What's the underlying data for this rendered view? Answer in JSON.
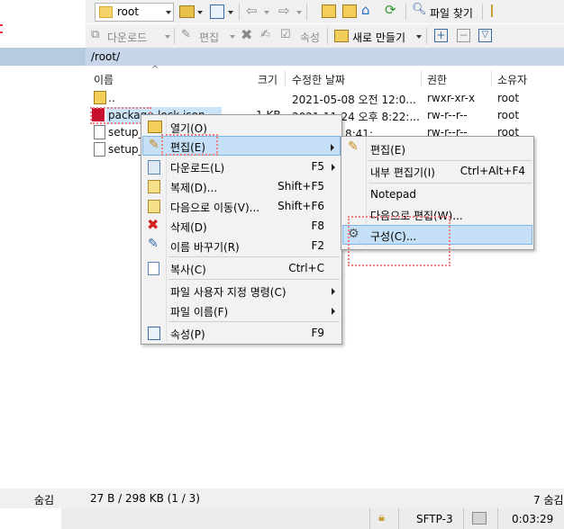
{
  "toolbar": {
    "location_value": "root",
    "find_files_label": "파일 찾기",
    "download_label": "다운로드",
    "edit_label": "편집",
    "properties_label": "속성",
    "new_label": "새로 만들기"
  },
  "path": "/root/",
  "columns": {
    "name": "이름",
    "size": "크기",
    "modified": "수정한 날짜",
    "permissions": "권한",
    "owner": "소유자"
  },
  "files": [
    {
      "name": "..",
      "size": "",
      "modified": "2021-05-08 오전 12:0...",
      "permissions": "rwxr-xr-x",
      "owner": "root"
    },
    {
      "name": "package-lock.json",
      "size": "1 KB",
      "modified": "2021-11-24 오후 8:22:...",
      "permissions": "rw-r--r--",
      "owner": "root"
    },
    {
      "name": "setup_",
      "size": "",
      "modified": "24 오후 8:41:...",
      "permissions": "rw-r--r--",
      "owner": "root"
    },
    {
      "name": "setup_",
      "size": "",
      "modified": "",
      "permissions": "",
      "owner": ""
    }
  ],
  "context_menu": {
    "items": [
      {
        "label": "열기(O)",
        "shortcut": ""
      },
      {
        "label": "편집(E)",
        "shortcut": ""
      },
      {
        "label": "다운로드(L)",
        "shortcut": "F5"
      },
      {
        "label": "복제(D)...",
        "shortcut": "Shift+F5"
      },
      {
        "label": "다음으로 이동(V)...",
        "shortcut": "Shift+F6"
      },
      {
        "label": "삭제(D)",
        "shortcut": "F8"
      },
      {
        "label": "이름 바꾸기(R)",
        "shortcut": "F2"
      },
      {
        "label": "복사(C)",
        "shortcut": "Ctrl+C"
      },
      {
        "label": "파일 사용자 지정 명령(C)",
        "shortcut": ""
      },
      {
        "label": "파일 이름(F)",
        "shortcut": ""
      },
      {
        "label": "속성(P)",
        "shortcut": "F9"
      }
    ]
  },
  "submenu": {
    "items": [
      {
        "label": "편집(E)",
        "shortcut": ""
      },
      {
        "label": "내부 편집기(I)",
        "shortcut": "Ctrl+Alt+F4"
      },
      {
        "label": "Notepad",
        "shortcut": ""
      },
      {
        "label": "다음으로 편집(W)...",
        "shortcut": ""
      },
      {
        "label": "구성(C)...",
        "shortcut": ""
      }
    ]
  },
  "status": {
    "left_hidden": "숨김",
    "selection": "27 B / 298 KB (1 / 3)",
    "right_hidden": "7 숨김",
    "protocol": "SFTP-3",
    "time": "0:03:29"
  }
}
